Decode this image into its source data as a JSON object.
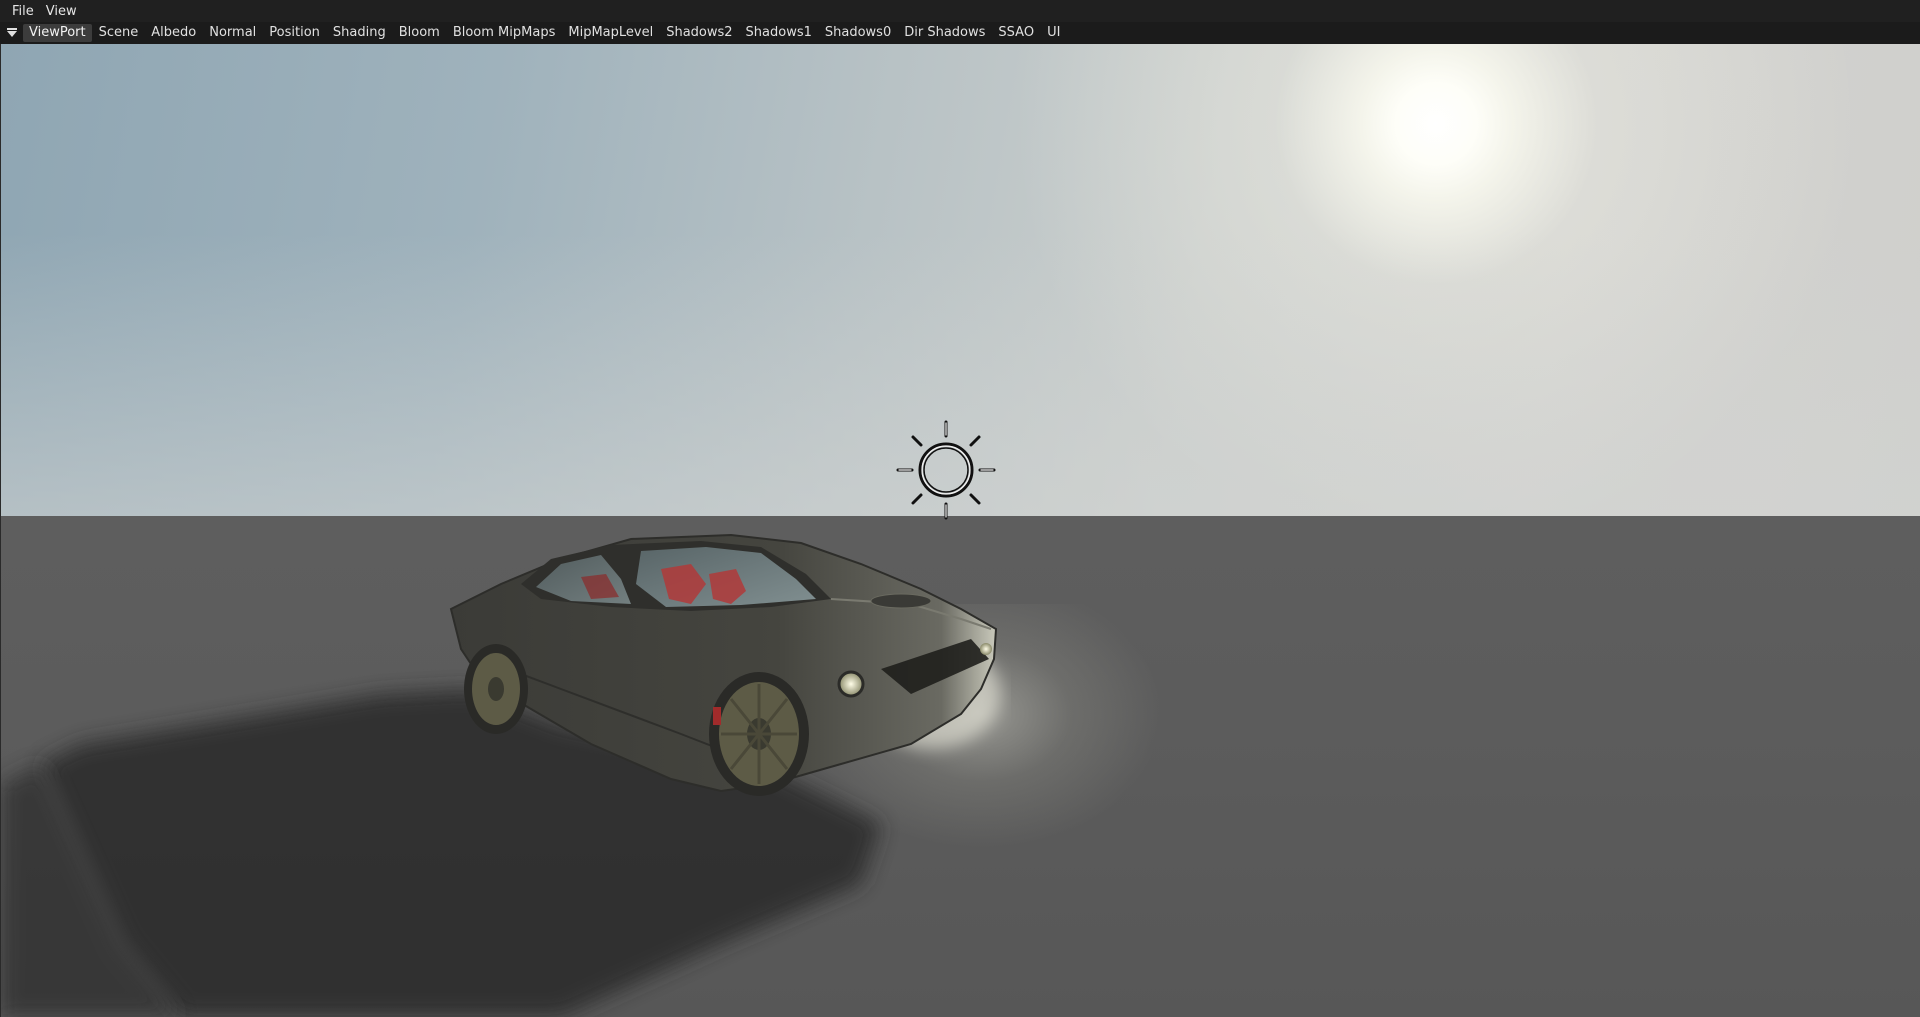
{
  "menubar": {
    "items": [
      "File",
      "View"
    ]
  },
  "tabs": {
    "dropdown_icon": "triangle-down-icon",
    "items": [
      "ViewPort",
      "Scene",
      "Albedo",
      "Normal",
      "Position",
      "Shading",
      "Bloom",
      "Bloom MipMaps",
      "MipMapLevel",
      "Shadows2",
      "Shadows1",
      "Shadows0",
      "Dir Shadows",
      "SSAO",
      "UI"
    ],
    "active": "ViewPort"
  },
  "viewport": {
    "light_icon": "sun-light-gizmo-icon",
    "sun_icon": "sun-icon",
    "object": "car-model"
  },
  "colors": {
    "menubar_bg": "#202020",
    "tabbar_bg": "#1b1b1b",
    "active_tab_bg": "#3c3c3c",
    "sky_left": "#8fa6b3",
    "sky_right": "#d3d3d0",
    "ground": "#5e5e5e"
  }
}
